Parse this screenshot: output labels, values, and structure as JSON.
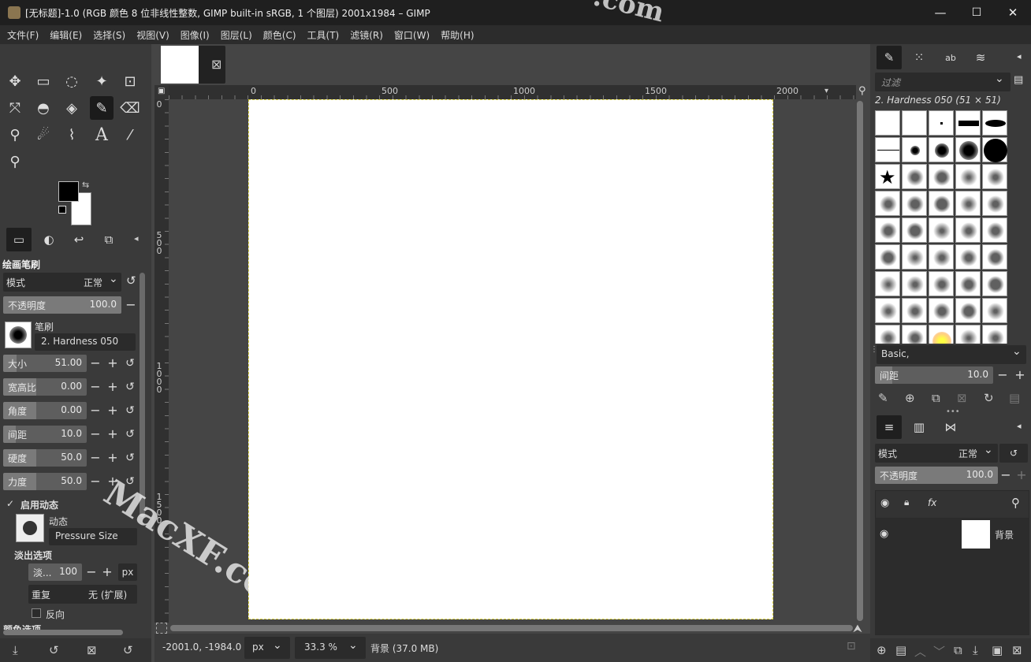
{
  "window": {
    "title": "[无标题]-1.0 (RGB 颜色 8 位非线性整数, GIMP built-in sRGB, 1 个图层) 2001x1984 – GIMP",
    "min": "—",
    "max": "☐",
    "close": "✕"
  },
  "menu": [
    "文件(F)",
    "编辑(E)",
    "选择(S)",
    "视图(V)",
    "图像(I)",
    "图层(L)",
    "颜色(C)",
    "工具(T)",
    "滤镜(R)",
    "窗口(W)",
    "帮助(H)"
  ],
  "tool_options": {
    "section_title": "绘画笔刷",
    "mode_label": "模式",
    "mode_value": "正常",
    "opacity_label": "不透明度",
    "opacity_value": "100.0",
    "brush_label": "笔刷",
    "brush_value": "2. Hardness 050",
    "params": [
      {
        "label": "大小",
        "value": "51.00",
        "fill": 0.16
      },
      {
        "label": "宽高比",
        "value": "0.00",
        "fill": 0.4
      },
      {
        "label": "角度",
        "value": "0.00",
        "fill": 0.4
      },
      {
        "label": "间距",
        "value": "10.0",
        "fill": 0.15
      },
      {
        "label": "硬度",
        "value": "50.0",
        "fill": 0.4
      },
      {
        "label": "力度",
        "value": "50.0",
        "fill": 0.4
      }
    ],
    "dynamics_enable": "启用动态",
    "dynamics_label": "动态",
    "dynamics_value": "Pressure Size",
    "fade_section": "淡出选项",
    "fade_label": "淡...",
    "fade_value": "100",
    "fade_unit": "px",
    "repeat_label": "重复",
    "repeat_value": "无 (扩展)",
    "reverse_label": "反向",
    "cut_label": "颜色选项"
  },
  "ruler": {
    "h": [
      "0",
      "500",
      "1000",
      "1500",
      "2000"
    ],
    "v": [
      "0",
      "500",
      "1000",
      "1500"
    ]
  },
  "status": {
    "coords": "-2001.0, -1984.0",
    "unit": "px",
    "zoom": "33.3 %",
    "info": "背景 (37.0 MB)"
  },
  "brushes": {
    "filter_placeholder": "过滤",
    "current": "2. Hardness 050 (51 × 51)",
    "set": "Basic,",
    "spacing_label": "间距",
    "spacing_value": "10.0"
  },
  "layers": {
    "mode_label": "模式",
    "mode_value": "正常",
    "opacity_label": "不透明度",
    "opacity_value": "100.0",
    "layer_name": "背景"
  },
  "watermark": {
    "text1": "MacXF.com",
    "text2": ".com"
  },
  "icons": {
    "move": "✥",
    "rect": "▭",
    "lasso": "◌",
    "wand": "✦",
    "crop": "⊡",
    "transform": "⤧",
    "warp": "◓",
    "bucket": "◈",
    "brush": "✎",
    "eraser": "⌫",
    "clone": "⚲",
    "smudge": "☄",
    "path": "⌇",
    "text": "A",
    "picker": "⁄",
    "zoom": "⚲",
    "swap": "⇆",
    "chev": "⌄",
    "reset": "↺",
    "minus": "−",
    "plus": "+",
    "eye": "◉",
    "lock": "🔒",
    "fx": "fx",
    "search": "⚲",
    "check": "✓",
    "pin": "◂",
    "close_x": "⊠"
  }
}
